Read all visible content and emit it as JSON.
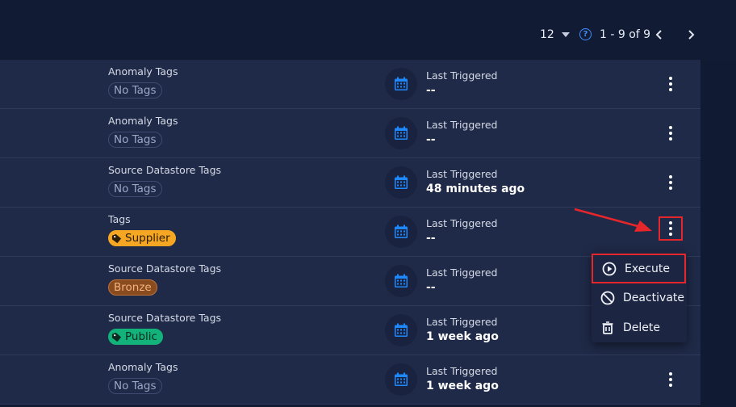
{
  "pagination": {
    "page_size": "12",
    "range": "1 - 9 of 9",
    "help_glyph": "?"
  },
  "rows": [
    {
      "tag_label": "Anomaly Tags",
      "tag": "No Tags",
      "tag_style": "none",
      "trigger_label": "Last Triggered",
      "trigger_value": "--"
    },
    {
      "tag_label": "Anomaly Tags",
      "tag": "No Tags",
      "tag_style": "none",
      "trigger_label": "Last Triggered",
      "trigger_value": "--"
    },
    {
      "tag_label": "Source Datastore Tags",
      "tag": "No Tags",
      "tag_style": "none",
      "trigger_label": "Last Triggered",
      "trigger_value": "48 minutes ago"
    },
    {
      "tag_label": "Tags",
      "tag": "Supplier",
      "tag_style": "supplier",
      "trigger_label": "Last Triggered",
      "trigger_value": "--"
    },
    {
      "tag_label": "Source Datastore Tags",
      "tag": "Bronze",
      "tag_style": "bronze",
      "trigger_label": "Last Triggered",
      "trigger_value": "--"
    },
    {
      "tag_label": "Source Datastore Tags",
      "tag": "Public",
      "tag_style": "public",
      "trigger_label": "Last Triggered",
      "trigger_value": "1 week ago"
    },
    {
      "tag_label": "Anomaly Tags",
      "tag": "No Tags",
      "tag_style": "none",
      "trigger_label": "Last Triggered",
      "trigger_value": "1 week ago"
    }
  ],
  "context_menu": {
    "items": [
      {
        "label": "Execute",
        "icon": "play-circle-icon"
      },
      {
        "label": "Deactivate",
        "icon": "block-icon"
      },
      {
        "label": "Delete",
        "icon": "trash-icon"
      }
    ]
  },
  "colors": {
    "background": "#111a33",
    "row": "#1f2a48",
    "accent": "#1e88ff",
    "highlight": "#e5262a"
  }
}
